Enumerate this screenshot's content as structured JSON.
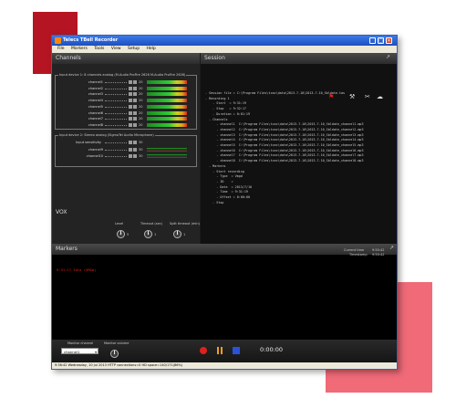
{
  "window": {
    "title": "Telecs TBell Recorder"
  },
  "menu": [
    "File",
    "Markers",
    "Tools",
    "View",
    "Setup",
    "Help"
  ],
  "channels": {
    "title": "Channels",
    "device1": {
      "label": "Input device 1: 8 channels analog (M-Audio ProFire 2626 M-Audio ProFire 2626)",
      "rows": [
        {
          "name": "channel1",
          "gain": "20"
        },
        {
          "name": "channel2",
          "gain": "20"
        },
        {
          "name": "channel3",
          "gain": "20"
        },
        {
          "name": "channel4",
          "gain": "20"
        },
        {
          "name": "channel5",
          "gain": "20"
        },
        {
          "name": "channel6",
          "gain": "20"
        },
        {
          "name": "channel7",
          "gain": "20"
        },
        {
          "name": "channel8",
          "gain": "20"
        }
      ]
    },
    "device2": {
      "label": "Input device 2: Stereo analog (SigmaTel Audio Microphone)",
      "sensitivity_label": "Input sensitivity",
      "sensitivity_value": "30",
      "rows": [
        {
          "name": "channel9",
          "gain": "30"
        },
        {
          "name": "channel10",
          "gain": "30"
        }
      ]
    }
  },
  "session": {
    "title": "Session",
    "tree": [
      "- Session file = C:\\Program Files\\tcac\\data\\2013-7-10\\2013-7-10_Sbldate.tas",
      "- Recording 1",
      "    - Start  = 9:31:19",
      "    - Stop   = 9:32:17",
      "    - Duration = 0:01:19",
      "  - Channels",
      "      - channel1  C:\\Program Files\\tcac\\data\\2013-7-10\\2013-7-10_Sbldate_channel1.mp3",
      "      - channel2  C:\\Program Files\\tcac\\data\\2013-7-10\\2013-7-10_Sbldate_channel2.mp3",
      "      - channel3  C:\\Program Files\\tcac\\data\\2013-7-10\\2013-7-10_Sbldate_channel3.mp3",
      "      - channel4  C:\\Program Files\\tcac\\data\\2013-7-10\\2013-7-10_Sbldate_channel4.mp3",
      "      - channel5  C:\\Program Files\\tcac\\data\\2013-7-10\\2013-7-10_Sbldate_channel5.mp3",
      "      - channel6  C:\\Program Files\\tcac\\data\\2013-7-10\\2013-7-10_Sbldate_channel6.mp3",
      "      - channel7  C:\\Program Files\\tcac\\data\\2013-7-10\\2013-7-10_Sbldate_channel7.mp3",
      "      - channel8  C:\\Program Files\\tcac\\data\\2013-7-10\\2013-7-10_Sbldate_channel8.mp3",
      "  - Markers",
      "    - Start recording",
      "      - Type  = Vmgd",
      "      - ID    =",
      "      - Date  = 2013/7/10",
      "      - Time  = 9:31:19",
      "      - Offset = 0:00:00",
      "    - Stop"
    ]
  },
  "vox": {
    "title": "VOX",
    "knobs": [
      {
        "label": "Level",
        "value": "5"
      },
      {
        "label": "Timeout (sec)",
        "value": "1"
      },
      {
        "label": "Split timeout (min)",
        "value": "1"
      }
    ]
  },
  "markers": {
    "title": "Markers",
    "current_time_label": "Current time",
    "current_time_value": "9:50:42",
    "timestamp_label": "Timestamp",
    "timestamp_value": "9:50:42",
    "entries": [
      "9:31:17 Idle (VMGd)"
    ]
  },
  "bottom": {
    "monitor_channel_label": "Monitor channel",
    "monitor_channel_value": "channel1",
    "monitor_volume_label": "Monitor volume",
    "timer": "0:00:00"
  },
  "status": {
    "text": "9:36:42 Wednesday, 10 Jul 2013  HTTP connections=0  HD space=140/171(86%)"
  },
  "colors": {
    "accent_red": "#b51522",
    "accent_pink": "#f06a78",
    "rec_red": "#e0201a",
    "pause_orange": "#f2a01e",
    "stop_blue": "#2a52d8"
  }
}
